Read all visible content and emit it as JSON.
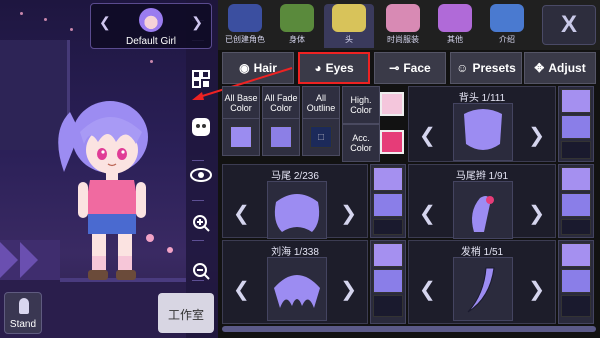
{
  "character_selector": {
    "name": "Default Girl",
    "prev_icon": "chevron-left-icon",
    "next_icon": "chevron-right-icon"
  },
  "left_toolbar": {
    "icons": [
      "qr-code-icon",
      "face-toggle-icon",
      "eye-icon",
      "zoom-in-icon",
      "zoom-out-icon"
    ]
  },
  "bottom_left": {
    "stand_label": "Stand",
    "studio_label": "工作室"
  },
  "categories": [
    {
      "label": "已创建角色",
      "icon": "created-characters-icon"
    },
    {
      "label": "身体",
      "icon": "body-icon"
    },
    {
      "label": "头",
      "icon": "head-icon"
    },
    {
      "label": "时尚服装",
      "icon": "fashion-icon"
    },
    {
      "label": "其他",
      "icon": "other-icon"
    },
    {
      "label": "介绍",
      "icon": "intro-icon"
    }
  ],
  "active_category": "头",
  "close_label": "X",
  "tabs": [
    {
      "label": "Hair",
      "icon": "hair-icon"
    },
    {
      "label": "Eyes",
      "icon": "eye-icon"
    },
    {
      "label": "Face",
      "icon": "face-icon"
    },
    {
      "label": "Presets",
      "icon": "presets-icon"
    },
    {
      "label": "Adjust",
      "icon": "adjust-icon"
    }
  ],
  "color_options": {
    "all_base": "All Base Color",
    "all_fade": "All Fade Color",
    "all_outline": "All Outline",
    "high_color": "High. Color",
    "acc_color": "Acc. Color",
    "outline_symbol": "□"
  },
  "parts": [
    {
      "name": "背头",
      "index": "1/111",
      "colors": [
        "#a590f0",
        "#8a7ee8",
        "#1a1a2e"
      ]
    },
    {
      "name": "马尾",
      "index": "2/236",
      "colors": [
        "#a590f0",
        "#8a7ee8",
        "#1a1a2e"
      ]
    },
    {
      "name": "马尾辫",
      "index": "1/91",
      "colors": [
        "#a590f0",
        "#8a7ee8",
        "#1a1a2e"
      ]
    },
    {
      "name": "刘海",
      "index": "1/338",
      "colors": [
        "#a590f0",
        "#8a7ee8",
        "#1a1a2e"
      ]
    },
    {
      "name": "发梢",
      "index": "1/51",
      "colors": [
        "#a590f0",
        "#8a7ee8",
        "#1a1a2e"
      ]
    }
  ],
  "colors": {
    "panel_bg": "#121212",
    "hair_purple": "#9c8cf2",
    "swatch_base": "#9b8cf0",
    "swatch_fade": "#8c7fe6",
    "swatch_outline": "#1c2a5a",
    "high_swatch": "#f4c6dc",
    "acc_swatch": "#e63c78",
    "highlight_red": "#e22222"
  }
}
